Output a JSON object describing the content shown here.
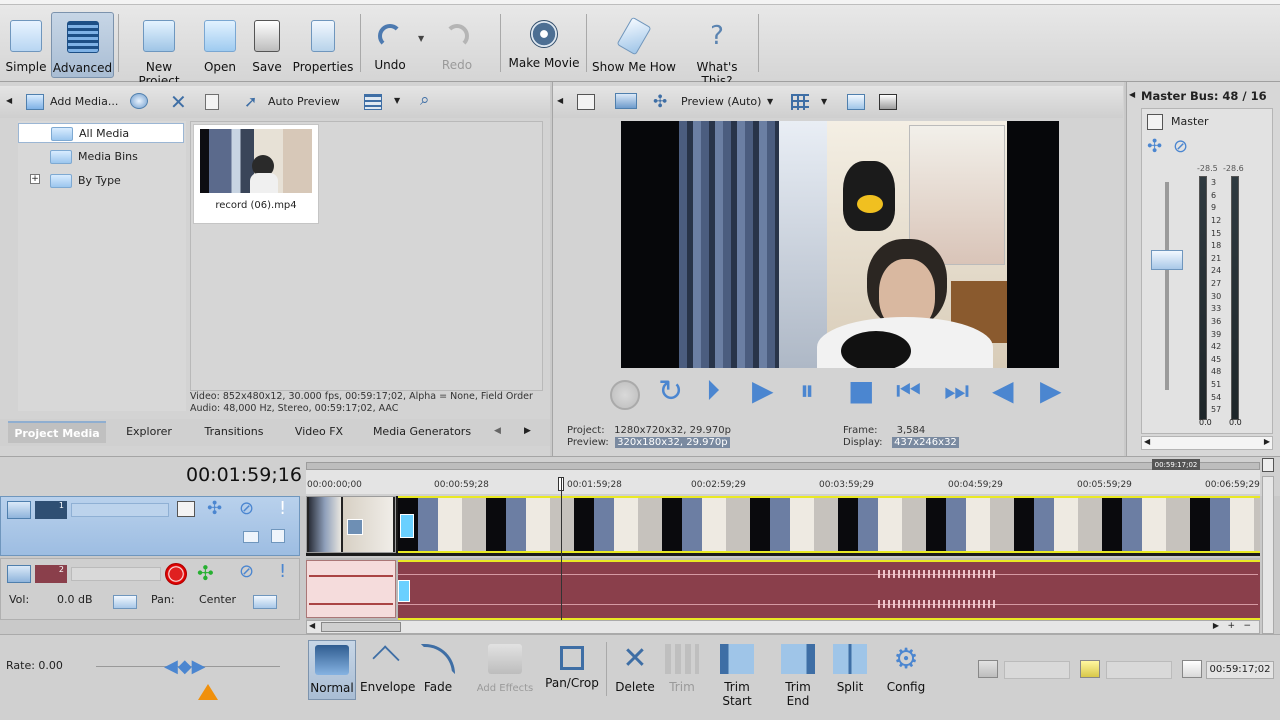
{
  "toolbar": {
    "buttons": [
      {
        "label": "Simple",
        "icon": "simple-view-icon"
      },
      {
        "label": "Advanced",
        "icon": "advanced-view-icon"
      },
      {
        "label": "New Project",
        "icon": "new-project-icon"
      },
      {
        "label": "Open",
        "icon": "open-folder-icon"
      },
      {
        "label": "Save",
        "icon": "save-disk-icon"
      },
      {
        "label": "Properties",
        "icon": "properties-icon"
      },
      {
        "label": "Undo",
        "icon": "undo-icon"
      },
      {
        "label": "Redo",
        "icon": "redo-icon"
      },
      {
        "label": "Make Movie",
        "icon": "film-reel-icon"
      },
      {
        "label": "Show Me How",
        "icon": "show-me-how-icon"
      },
      {
        "label": "What's This?",
        "icon": "help-cursor-icon"
      }
    ]
  },
  "media": {
    "add_media": "Add Media...",
    "auto_preview": "Auto Preview",
    "tree": [
      "All Media",
      "Media Bins",
      "By Type"
    ],
    "file_name": "record (06).mp4",
    "info_line1": "Video: 852x480x12, 30.000 fps, 00:59:17;02, Alpha = None, Field Order",
    "info_line2": "Audio: 48,000 Hz, Stereo, 00:59:17;02, AAC",
    "tabs": [
      "Project Media",
      "Explorer",
      "Transitions",
      "Video FX",
      "Media Generators"
    ]
  },
  "preview": {
    "mode": "Preview (Auto)",
    "project_label": "Project:",
    "project_value": "1280x720x32, 29.970p",
    "preview_label": "Preview:",
    "preview_value": "320x180x32, 29.970p",
    "frame_label": "Frame:",
    "frame_value": "3,584",
    "display_label": "Display:",
    "display_value": "437x246x32"
  },
  "master": {
    "title": "Master Bus: 48 / 16",
    "name": "Master",
    "peak_left": "-28.5",
    "peak_right": "-28.6",
    "scale": [
      "3",
      "6",
      "9",
      "12",
      "15",
      "18",
      "21",
      "24",
      "27",
      "30",
      "33",
      "36",
      "39",
      "42",
      "45",
      "48",
      "51",
      "54",
      "57"
    ],
    "bottom_left": "0.0",
    "bottom_right": "0.0"
  },
  "timeline": {
    "current_time": "00:01:59;16",
    "ticks": [
      "00:00:00;00",
      "00:00:59;28",
      "00:01:59;28",
      "00:02:59;29",
      "00:03:59;29",
      "00:04:59;29",
      "00:05:59;29",
      "00:06:59;29"
    ],
    "end_marker": "00:59:17;02",
    "track1_num": "1",
    "track2_num": "2",
    "vol_label": "Vol:",
    "vol_value": "0.0 dB",
    "pan_label": "Pan:",
    "pan_value": "Center",
    "rate": "Rate: 0.00"
  },
  "edit_toolbar": {
    "buttons": [
      {
        "label": "Normal",
        "icon": "normal-edit-icon"
      },
      {
        "label": "Envelope",
        "icon": "envelope-icon"
      },
      {
        "label": "Fade",
        "icon": "fade-icon"
      },
      {
        "label": "Add Effects",
        "icon": "add-effects-icon"
      },
      {
        "label": "Pan/Crop",
        "icon": "pan-crop-icon"
      },
      {
        "label": "Delete",
        "icon": "delete-x-icon"
      },
      {
        "label": "Trim",
        "icon": "trim-icon"
      },
      {
        "label": "Trim Start",
        "icon": "trim-start-icon"
      },
      {
        "label": "Trim End",
        "icon": "trim-end-icon"
      },
      {
        "label": "Split",
        "icon": "split-icon"
      },
      {
        "label": "Config",
        "icon": "gear-icon"
      }
    ],
    "end_time": "00:59:17;02"
  }
}
